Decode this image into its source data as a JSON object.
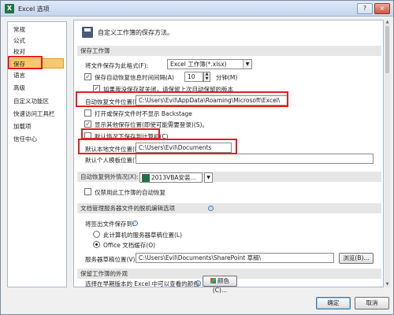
{
  "window": {
    "title": "Excel 选项",
    "minimize": "?",
    "close": "×"
  },
  "sidebar": {
    "items": [
      {
        "label": "常规"
      },
      {
        "label": "公式"
      },
      {
        "label": "校对"
      },
      {
        "label": "保存",
        "selected": true
      },
      {
        "label": "语言"
      },
      {
        "label": "高级"
      },
      {
        "label": "自定义功能区"
      },
      {
        "label": "快速访问工具栏"
      },
      {
        "label": "加载项"
      },
      {
        "label": "信任中心"
      }
    ]
  },
  "main": {
    "header": "自定义工作簿的保存方法。",
    "save_workbooks": {
      "section_title": "保存工作簿",
      "format_label": "将文件保存为此格式(F):",
      "format_value": "Excel 工作簿(*.xlsx)",
      "autorecover_label": "保存自动恢复信息时间间隔(A)",
      "autorecover_minutes": "10",
      "minutes_unit": "分钟(M)",
      "keep_last_label": "如果我没保存就关闭，请保留上次自动保留的版本",
      "autorecover_location_label": "自动恢复文件位置(R):",
      "autorecover_location_value": "C:\\Users\\Evil\\AppData\\Roaming\\Microsoft\\Excel\\",
      "no_backstage_label": "打开或保存文件时不显示 Backstage",
      "show_other_locations_label": "显示其他保存位置(即使可能需要登录)(S)。",
      "save_to_computer_label": "默认情况下保存到计算机(C)",
      "default_local_label": "默认本地文件位置(I):",
      "default_local_value": "C:\\Users\\Evil\\Documents",
      "personal_templates_label": "默认个人模板位置(T):",
      "personal_templates_value": ""
    },
    "autorecover_exceptions": {
      "section_title": "自动恢复例外情况(X):",
      "workbook_value": "2013VBA安装...",
      "disable_label": "仅禁用此工作簿的自动恢复"
    },
    "offline_editing": {
      "section_title": "文档管理服务器文件的脱机编辑选项",
      "checkout_label": "将签出文件保存到:",
      "option_server_drafts": "此计算机的服务器草稿位置(L)",
      "option_office_cache": "Office 文档缓存(O)",
      "drafts_location_label": "服务器草稿位置(V):",
      "drafts_location_value": "C:\\Users\\Evil\\Documents\\SharePoint 草稿\\",
      "browse_button": "浏览(B)..."
    },
    "preserve_visual": {
      "section_title": "保留工作簿的外观",
      "colors_label": "选择在早期版本的 Excel 中可以查看的颜色:",
      "colors_button": "颜色(C)..."
    }
  },
  "footer": {
    "ok": "确定",
    "cancel": "取消"
  },
  "colors": {
    "selection": "#f7c96b",
    "annotation_red": "#e0201e",
    "excel_green": "#217346"
  }
}
